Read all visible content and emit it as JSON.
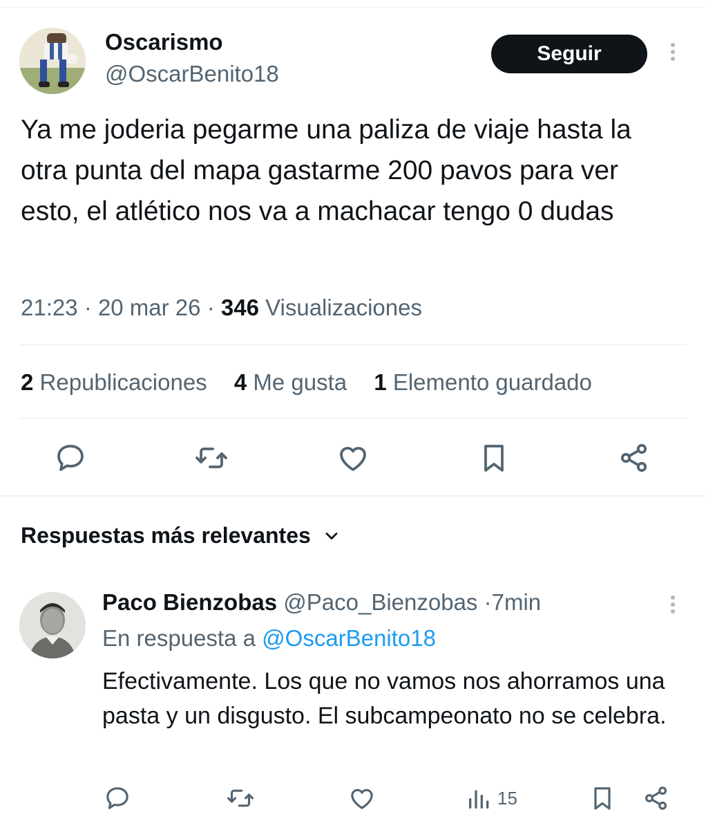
{
  "tweet": {
    "author_name": "Oscarismo",
    "author_handle": "@OscarBenito18",
    "follow_label": "Seguir",
    "text": "Ya me joderia pegarme una paliza de viaje hasta la otra punta del mapa gastarme 200 pavos para ver esto, el atlético nos va a machacar tengo 0 dudas",
    "time": "21:23",
    "date": "20 mar 26",
    "views_count": "346",
    "views_label": "Visualizaciones",
    "separator": "·",
    "stats": {
      "reposts_count": "2",
      "reposts_label": "Republicaciones",
      "likes_count": "4",
      "likes_label": "Me gusta",
      "bookmarks_count": "1",
      "bookmarks_label": "Elemento guardado"
    },
    "actions": [
      "reply-icon",
      "retweet-icon",
      "like-icon",
      "bookmark-icon",
      "share-icon"
    ]
  },
  "replies_section": {
    "sort_label": "Respuestas más relevantes",
    "sort_icon": "chevron-down-icon"
  },
  "reply": {
    "author_name": "Paco Bienzobas",
    "author_handle": "@Paco_Bienzobas",
    "separator": "·",
    "time_ago": "7min",
    "in_reply_prefix": "En respuesta a",
    "in_reply_handle": "@OscarBenito18",
    "text": "Efectivamente. Los que no vamos nos ahorramos una pasta y un disgusto. El subcampeonato no se celebra.",
    "views_count": "15",
    "actions": [
      "reply-icon",
      "retweet-icon",
      "like-icon",
      "views-icon",
      "bookmark-icon",
      "share-icon"
    ]
  },
  "colors": {
    "text": "#0f1419",
    "secondary": "#536471",
    "link": "#1d9bf0",
    "button_bg": "#0f1419",
    "divider": "#eff3f4"
  }
}
